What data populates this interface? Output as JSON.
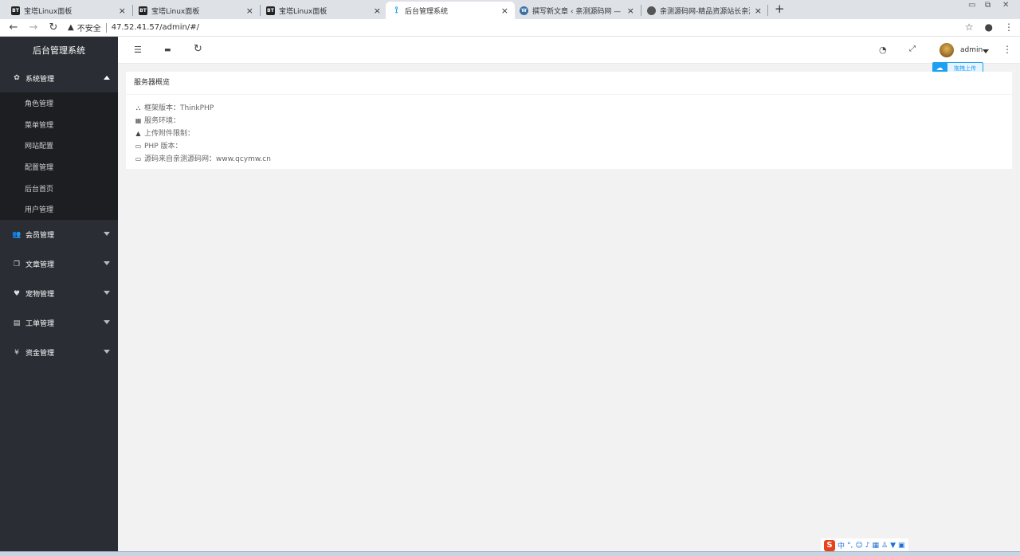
{
  "browser": {
    "tabs": [
      {
        "title": "宝塔Linux面板",
        "icon": "bt-favicon",
        "active": false
      },
      {
        "title": "宝塔Linux面板",
        "icon": "bt-favicon",
        "active": false
      },
      {
        "title": "宝塔Linux面板",
        "icon": "bt-favicon",
        "active": false
      },
      {
        "title": "后台管理系统",
        "icon": "y-favicon",
        "active": true
      },
      {
        "title": "撰写新文章 ‹ 亲测源码网 — Wo",
        "icon": "wordpress-favicon",
        "active": false
      },
      {
        "title": "亲测源码网-精品资源站长亲测",
        "icon": "globe-favicon",
        "active": false
      }
    ],
    "bt_badge": "BT",
    "close_glyph": "×",
    "new_tab_glyph": "+",
    "security_label": "不安全",
    "url": "47.52.41.57/admin/#/"
  },
  "sidebar": {
    "logo": "后台管理系统",
    "groups": [
      {
        "label": "系统管理",
        "icon": "gear-icon",
        "glyph": "✿",
        "open": true,
        "items": [
          "角色管理",
          "菜单管理",
          "网站配置",
          "配置管理",
          "后台首页",
          "用户管理"
        ]
      },
      {
        "label": "会员管理",
        "icon": "users-icon",
        "glyph": "👥",
        "open": false
      },
      {
        "label": "文章管理",
        "icon": "copy-icon",
        "glyph": "❐",
        "open": false
      },
      {
        "label": "宠物管理",
        "icon": "heart-icon",
        "glyph": "♥",
        "open": false
      },
      {
        "label": "工单管理",
        "icon": "file-icon",
        "glyph": "▤",
        "open": false
      },
      {
        "label": "资金管理",
        "icon": "yen-icon",
        "glyph": "¥",
        "open": false
      }
    ]
  },
  "header": {
    "username": "admin"
  },
  "upload_widget": {
    "label": "拖拽上传"
  },
  "card": {
    "title": "服务器概览",
    "rows": [
      {
        "icon": "sitemap-icon",
        "glyph": "⛬",
        "text": "框架版本：ThinkPHP"
      },
      {
        "icon": "windows-icon",
        "glyph": "▦",
        "text": "服务环境："
      },
      {
        "icon": "warning-icon",
        "glyph": "▲",
        "text": "上传附件限制："
      },
      {
        "icon": "credit-card-icon",
        "glyph": "▭",
        "text": "PHP 版本："
      },
      {
        "icon": "credit-card-icon",
        "glyph": "▭",
        "text": "源码来自亲测源码网：www.qcymw.cn"
      }
    ]
  },
  "ime": {
    "logo": "S",
    "mode": "中"
  },
  "colors": {
    "sidebar_bg": "#2a2d33",
    "submenu_bg": "#1c1e22",
    "accent": "#1e9ff2",
    "page_bg": "#f2f2f2"
  }
}
